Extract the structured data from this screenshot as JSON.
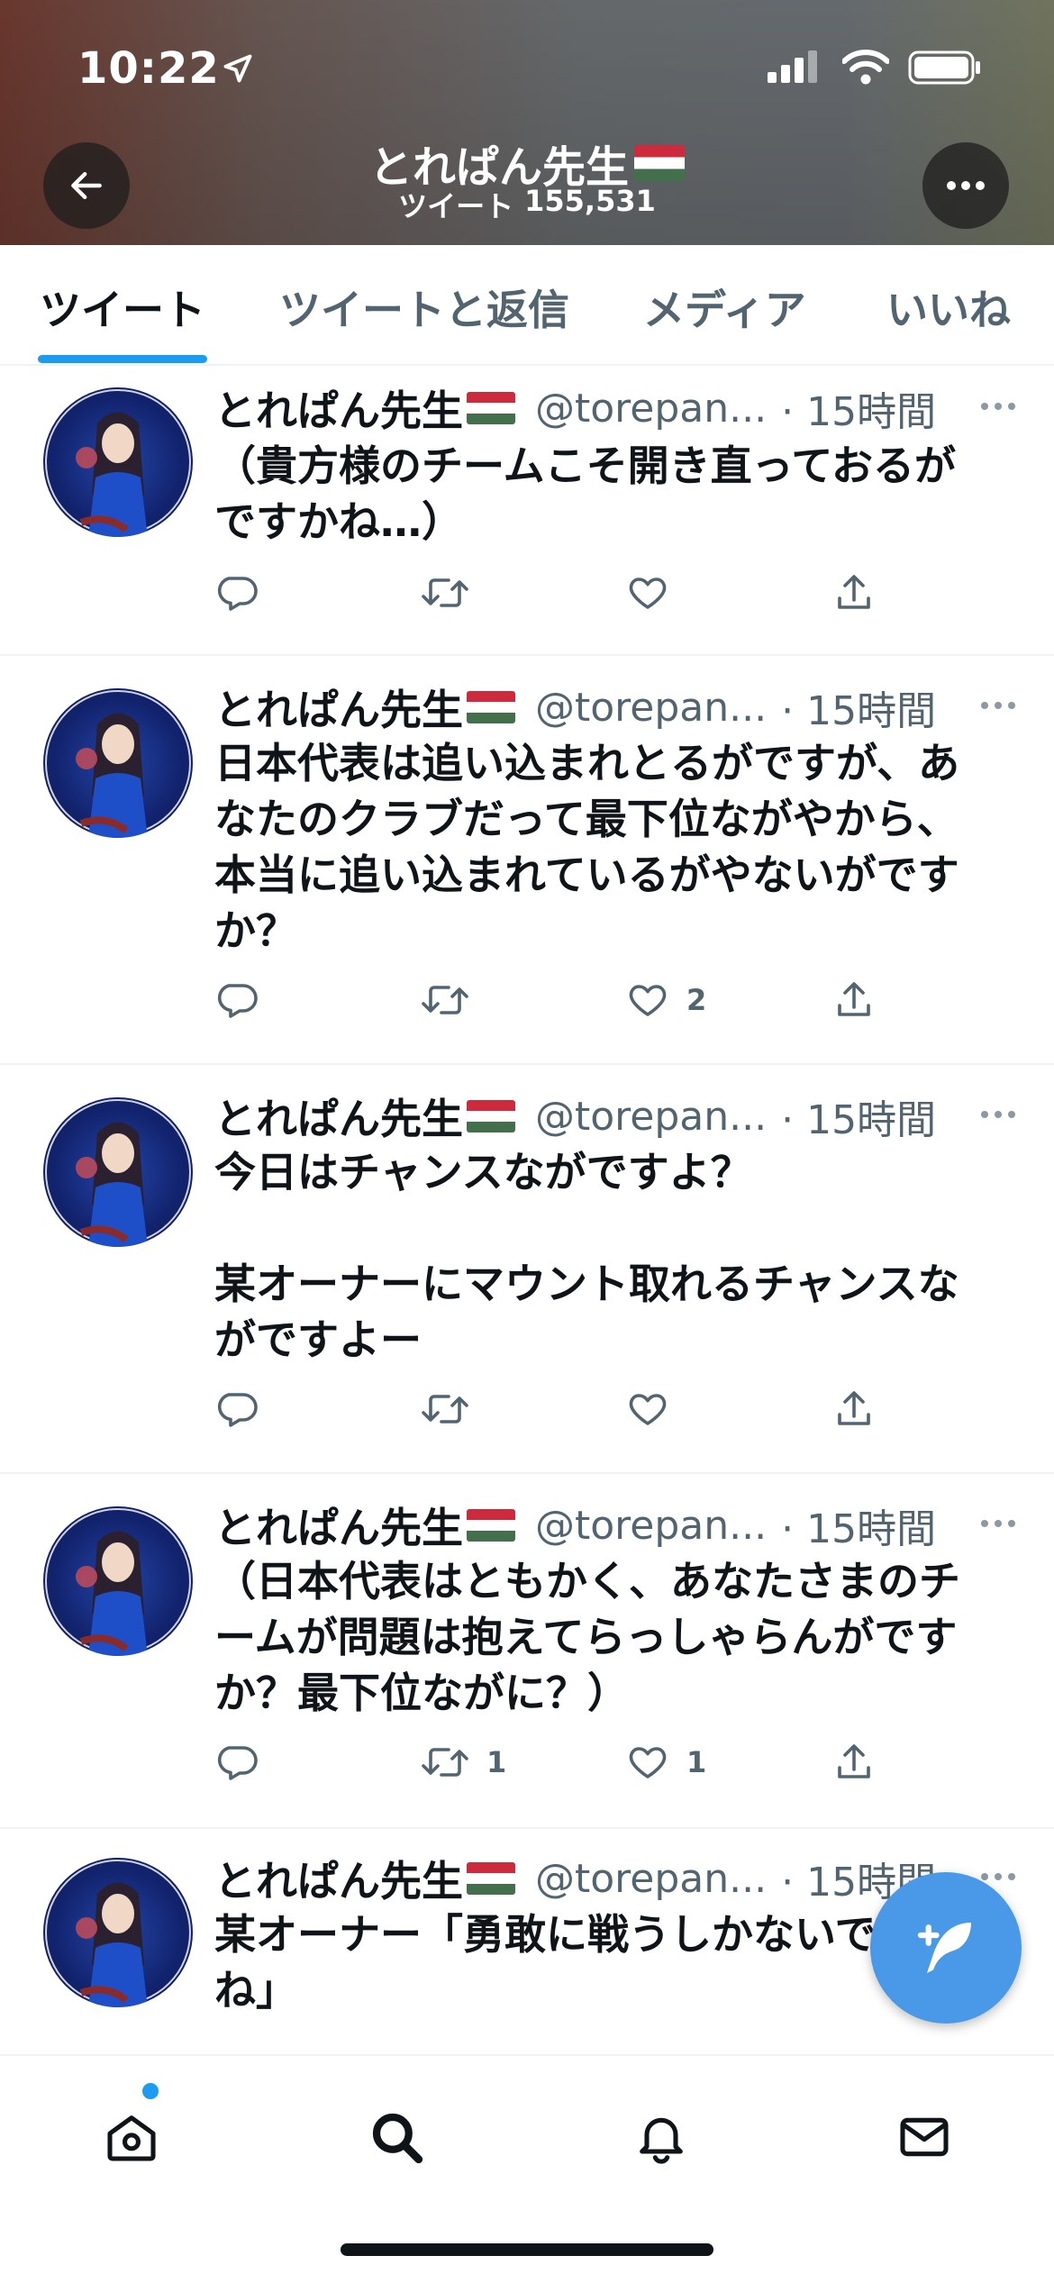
{
  "status_bar": {
    "time": "10:22"
  },
  "header": {
    "profile_name": "とれぱん先生",
    "tweet_count_label": "ツイート",
    "tweet_count": "155,531"
  },
  "tabs": [
    {
      "label": "ツイート",
      "active": true
    },
    {
      "label": "ツイートと返信",
      "active": false
    },
    {
      "label": "メディア",
      "active": false
    },
    {
      "label": "いいね",
      "active": false
    }
  ],
  "tweets": [
    {
      "name": "とれぱん先生",
      "handle": "@torepan...",
      "time": "· 15時間",
      "text": "（貴方様のチームこそ開き直っておるが\nですかね…）",
      "retweets": "",
      "likes": ""
    },
    {
      "name": "とれぱん先生",
      "handle": "@torepan...",
      "time": "· 15時間",
      "text": "日本代表は追い込まれとるがですが、あ\nなたのクラブだって最下位ながやから、\n本当に追い込まれているがやないがです\nか？",
      "retweets": "",
      "likes": "2"
    },
    {
      "name": "とれぱん先生",
      "handle": "@torepan...",
      "time": "· 15時間",
      "text": "今日はチャンスながですよ？\n\n某オーナーにマウント取れるチャンスな\nがですよー",
      "retweets": "",
      "likes": ""
    },
    {
      "name": "とれぱん先生",
      "handle": "@torepan...",
      "time": "· 15時間",
      "text": "（日本代表はともかく、あなたさまのチ\nームが問題は抱えてらっしゃらんがです\nか？最下位ながに？）",
      "retweets": "1",
      "likes": "1"
    },
    {
      "name": "とれぱん先生",
      "handle": "@torepan...",
      "time": "· 15時間",
      "text": "某オーナー「勇敢に戦うしかないです\nね」",
      "retweets": "",
      "likes": ""
    }
  ],
  "colors": {
    "accent": "#1d9bf0",
    "fab": "#4a99e9",
    "text_primary": "#0f1419",
    "text_secondary": "#536471",
    "divider": "#eff3f4"
  },
  "icons": {
    "back": "arrow-left-icon",
    "more": "more-horizontal-icon",
    "reply": "comment-icon",
    "retweet": "retweet-icon",
    "like": "heart-icon",
    "share": "share-icon",
    "compose": "compose-feather-icon",
    "home": "home-icon",
    "search": "search-icon",
    "notifications": "bell-icon",
    "messages": "mail-icon"
  }
}
